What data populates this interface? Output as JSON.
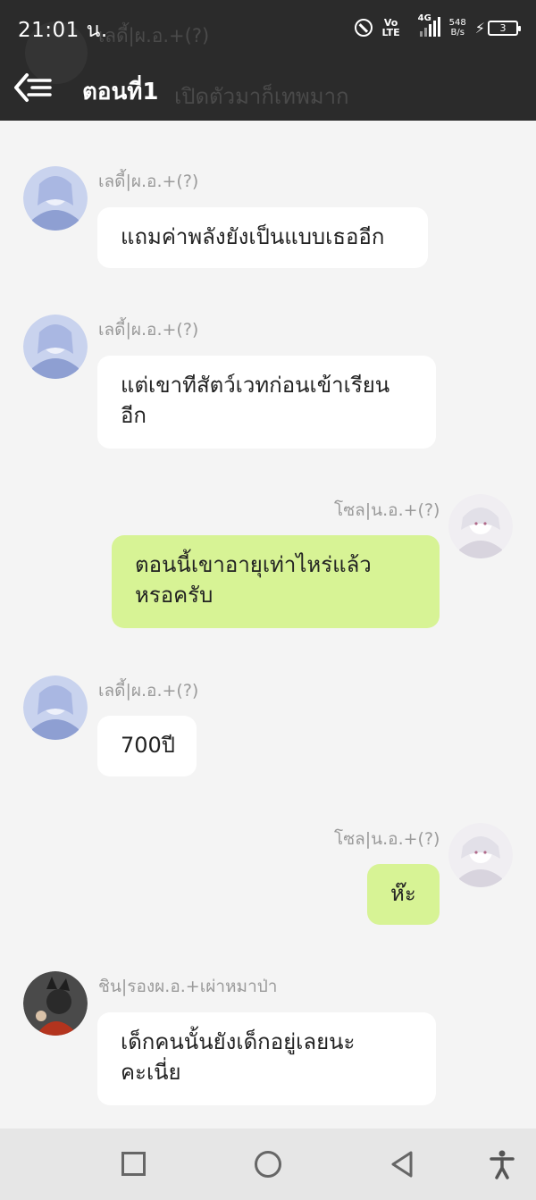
{
  "status_bar": {
    "time": "21:01 น.",
    "volte_top": "Vo",
    "volte_bottom": "LTE",
    "network": "4G",
    "speed_top": "548",
    "speed_bottom": "B/s",
    "battery": "3"
  },
  "header": {
    "title": "ตอนที่1",
    "background_color": "#2b2b2b",
    "ghost_sender": "เลดี้|ผ.อ.+(?)",
    "ghost_text": "เปิดตัวมาก็เทพมาก"
  },
  "messages": [
    {
      "sender": "เลดี้|ผ.อ.+(?)",
      "direction": "in",
      "lines": [
        "แถมค่าพลังยังเป็นแบบเธออีก"
      ]
    },
    {
      "sender": "เลดี้|ผ.อ.+(?)",
      "direction": "in",
      "lines": [
        "แต่เขาทีสัตว์เวทก่อนเข้าเรียน",
        "อีก"
      ]
    },
    {
      "sender": "โซล|น.อ.+(?)",
      "direction": "out",
      "lines": [
        "ตอนนี้เขาอายุเท่าไหร่แล้ว",
        "หรอครับ"
      ]
    },
    {
      "sender": "เลดี้|ผ.อ.+(?)",
      "direction": "in",
      "lines": [
        "700ปี"
      ]
    },
    {
      "sender": "โซล|น.อ.+(?)",
      "direction": "out",
      "lines": [
        "ห๊ะ"
      ]
    },
    {
      "sender": "ชิน|รองผ.อ.+เผ่าหมาป่า",
      "direction": "in",
      "lines": [
        "เด็กคนนั้นยังเด็กอยู่เลยนะ",
        "คะเนี่ย"
      ]
    }
  ],
  "colors": {
    "incoming_bubble": "#ffffff",
    "outgoing_bubble": "#d7f395",
    "chat_background": "#f4f4f4",
    "sender_text": "#9a9a9a"
  },
  "nav_bar": {
    "icons": [
      "recents-square-icon",
      "home-circle-icon",
      "back-triangle-icon",
      "accessibility-icon"
    ]
  }
}
